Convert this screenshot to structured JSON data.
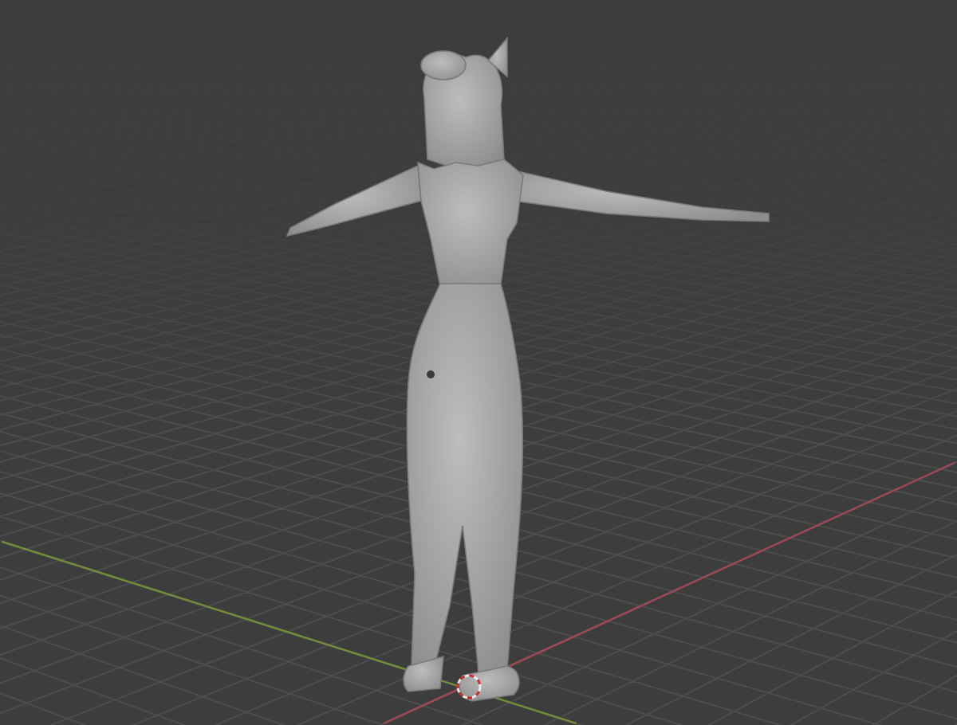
{
  "viewport": {
    "axes": [
      {
        "kind": "x",
        "color": "#9a4a52"
      },
      {
        "kind": "y",
        "color": "#6f8b3b"
      }
    ]
  }
}
